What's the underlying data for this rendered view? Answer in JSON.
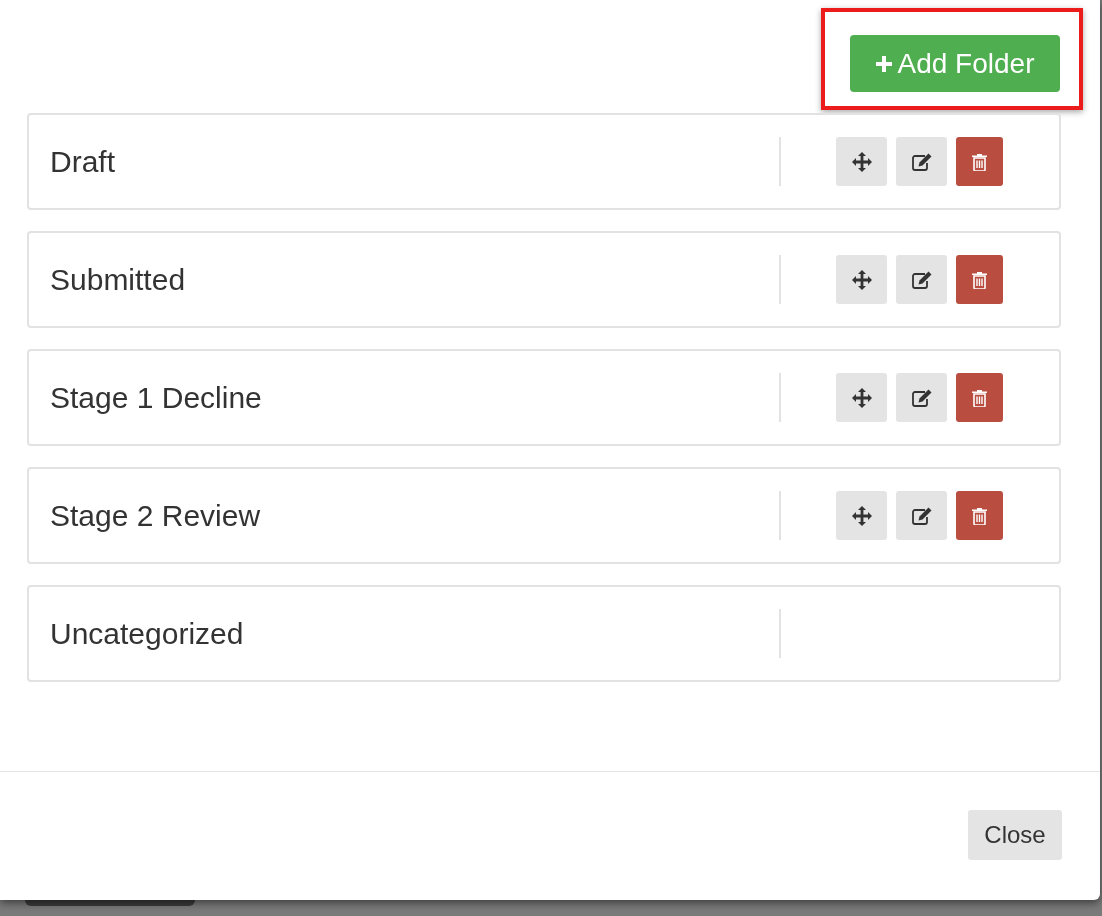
{
  "toolbar": {
    "add_button": {
      "label": "Add Folder",
      "highlighted": true
    }
  },
  "folders": [
    {
      "name": "Draft",
      "editable": true
    },
    {
      "name": "Submitted",
      "editable": true
    },
    {
      "name": "Stage 1 Decline",
      "editable": true
    },
    {
      "name": "Stage 2 Review",
      "editable": true
    },
    {
      "name": "Uncategorized",
      "editable": false
    }
  ],
  "footer": {
    "close_button": "Close"
  }
}
